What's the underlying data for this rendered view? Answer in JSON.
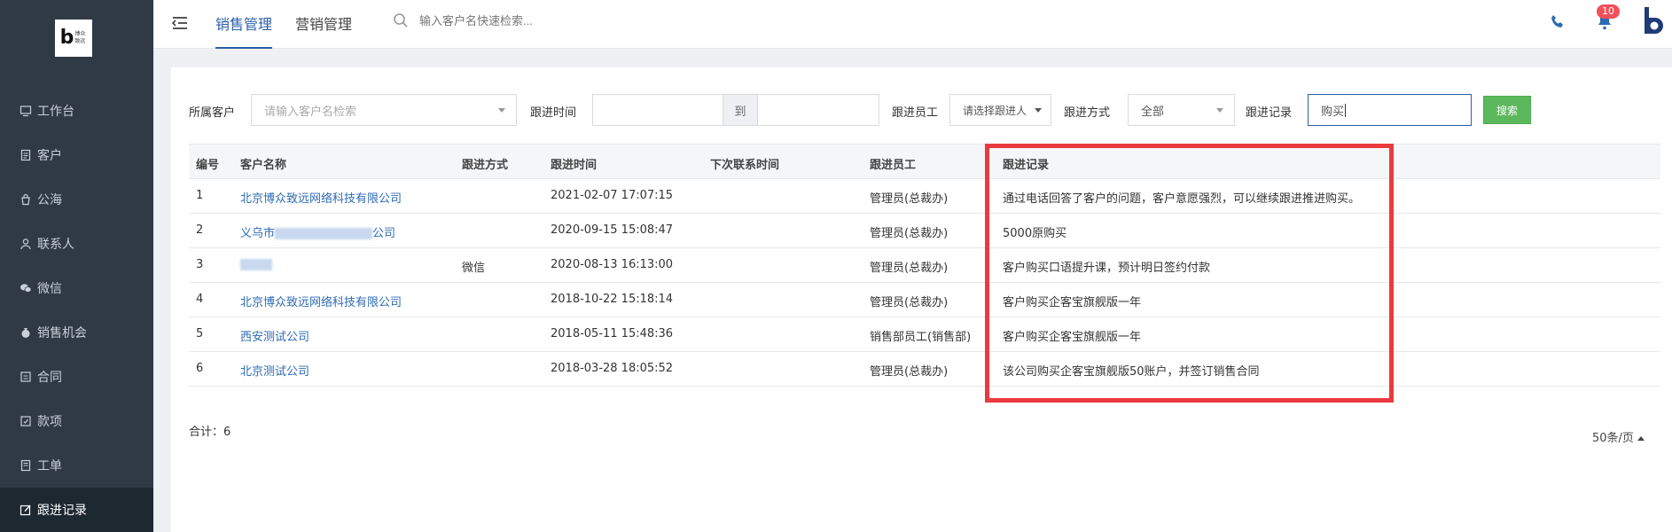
{
  "brand": {
    "logo_letter": "b",
    "logo_text": "博众致远"
  },
  "sidebar": {
    "items": [
      {
        "label": "工作台",
        "icon": "monitor-icon"
      },
      {
        "label": "客户",
        "icon": "document-icon"
      },
      {
        "label": "公海",
        "icon": "bag-icon"
      },
      {
        "label": "联系人",
        "icon": "person-icon"
      },
      {
        "label": "微信",
        "icon": "wechat-icon"
      },
      {
        "label": "销售机会",
        "icon": "money-bag-icon"
      },
      {
        "label": "合同",
        "icon": "contract-icon"
      },
      {
        "label": "款项",
        "icon": "payment-icon"
      },
      {
        "label": "工单",
        "icon": "ticket-icon"
      },
      {
        "label": "跟进记录",
        "icon": "edit-icon",
        "active": true
      }
    ]
  },
  "topbar": {
    "tabs": [
      {
        "label": "销售管理",
        "active": true
      },
      {
        "label": "营销管理",
        "active": false
      }
    ],
    "search_placeholder": "输入客户名快速检索...",
    "notification_count": "10"
  },
  "filters": {
    "customer_label": "所属客户",
    "customer_placeholder": "请输入客户名检索",
    "time_label": "跟进时间",
    "time_sep": "到",
    "staff_label": "跟进员工",
    "staff_placeholder": "请选择跟进人",
    "method_label": "跟进方式",
    "method_value": "全部",
    "record_label": "跟进记录",
    "record_value": "购买",
    "search_button": "搜索"
  },
  "table": {
    "headers": [
      "编号",
      "客户名称",
      "跟进方式",
      "跟进时间",
      "下次联系时间",
      "跟进员工",
      "跟进记录"
    ],
    "rows": [
      {
        "id": "1",
        "customer": "北京博众致远网络科技有限公司",
        "method": "",
        "time": "2021-02-07 17:07:15",
        "next": "",
        "staff": "管理员(总裁办)",
        "record": "通过电话回答了客户的问题，客户意愿强烈，可以继续跟进推进购买。"
      },
      {
        "id": "2",
        "customer_prefix": "义乌市",
        "customer_suffix": "公司",
        "method": "",
        "time": "2020-09-15 15:08:47",
        "next": "",
        "staff": "管理员(总裁办)",
        "record": "5000原购买"
      },
      {
        "id": "3",
        "customer_prefix": "",
        "customer_suffix": "",
        "method": "微信",
        "time": "2020-08-13 16:13:00",
        "next": "",
        "staff": "管理员(总裁办)",
        "record": "客户购买口语提升课，预计明日签约付款"
      },
      {
        "id": "4",
        "customer": "北京博众致远网络科技有限公司",
        "method": "",
        "time": "2018-10-22 15:18:14",
        "next": "",
        "staff": "管理员(总裁办)",
        "record": "客户购买企客宝旗舰版一年"
      },
      {
        "id": "5",
        "customer": "西安测试公司",
        "method": "",
        "time": "2018-05-11 15:48:36",
        "next": "",
        "staff": "销售部员工(销售部)",
        "record": "客户购买企客宝旗舰版一年"
      },
      {
        "id": "6",
        "customer": "北京测试公司",
        "method": "",
        "time": "2018-03-28 18:05:52",
        "next": "",
        "staff": "管理员(总裁办)",
        "record": "该公司购买企客宝旗舰版50账户，并签订销售合同"
      }
    ]
  },
  "footer": {
    "total": "合计：6",
    "page_size": "50条/页"
  },
  "colors": {
    "sidebar": "#2f3a45",
    "accent": "#2d5fa8",
    "link": "#2d6bb3",
    "highlight": "#ea3a3f",
    "search_btn": "#5cb85c",
    "badge": "#f0505a"
  }
}
